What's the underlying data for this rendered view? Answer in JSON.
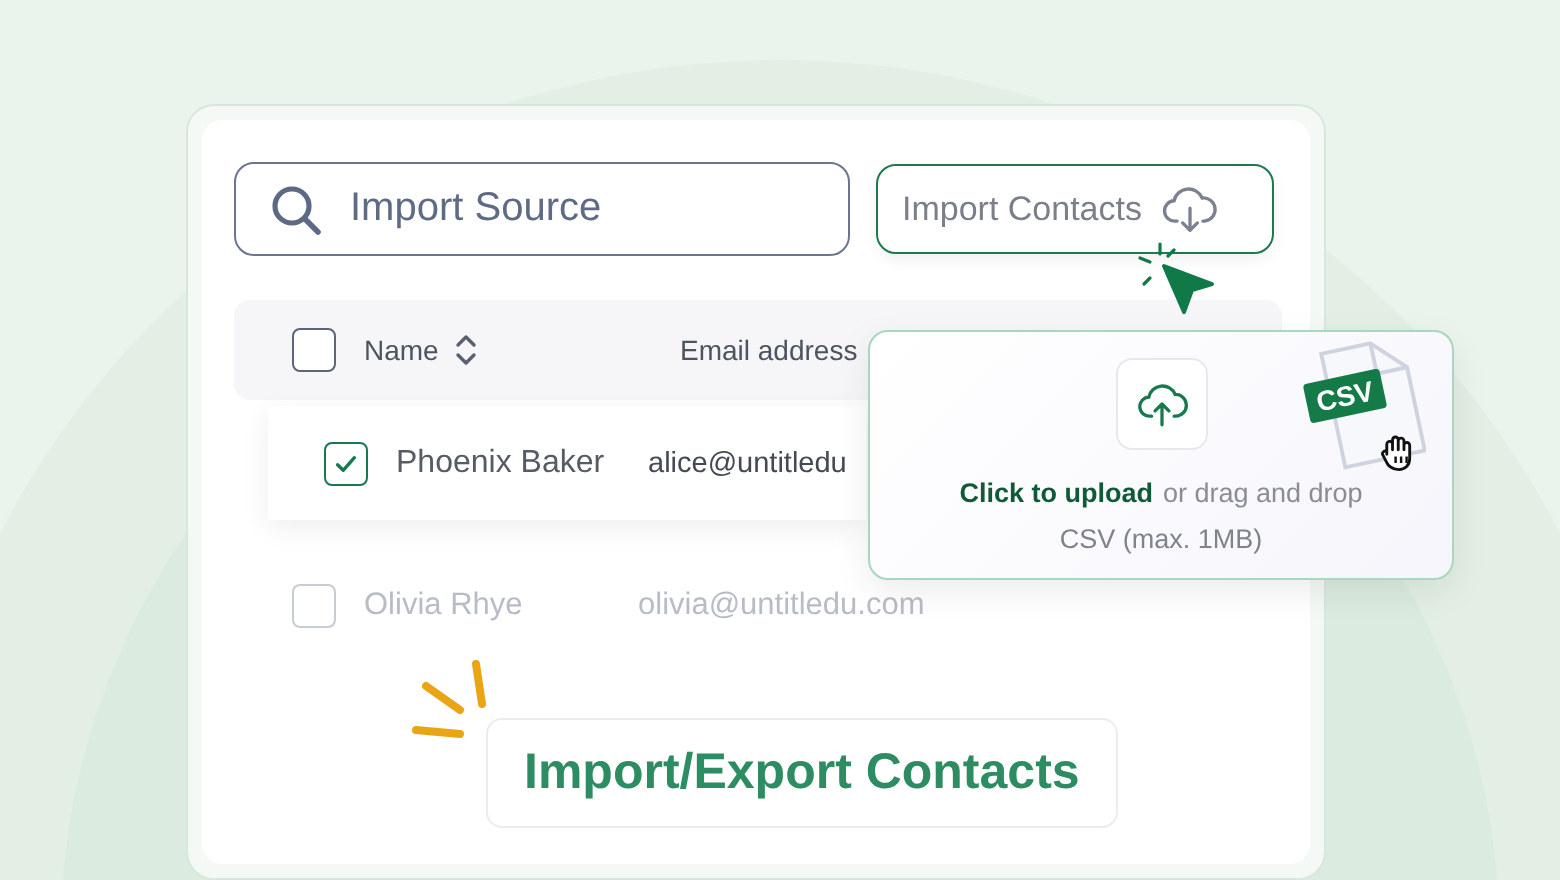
{
  "search": {
    "placeholder": "Import Source"
  },
  "import_button": {
    "label": "Import Contacts"
  },
  "table": {
    "header_checked": false,
    "columns": [
      {
        "label": "Name",
        "sortable": true
      },
      {
        "label": "Email address",
        "sortable": false
      }
    ],
    "rows": [
      {
        "name": "Phoenix Baker",
        "email": "alice@untitledu",
        "checked": true,
        "highlighted": true
      },
      {
        "name": "Olivia Rhye",
        "email": "olivia@untitledu.com",
        "checked": false,
        "highlighted": false
      }
    ]
  },
  "upload": {
    "action": "Click to upload",
    "hint": "or drag and drop",
    "limits": "CSV (max. 1MB)",
    "file_badge": "CSV"
  },
  "feature_title": "Import/Export Contacts"
}
